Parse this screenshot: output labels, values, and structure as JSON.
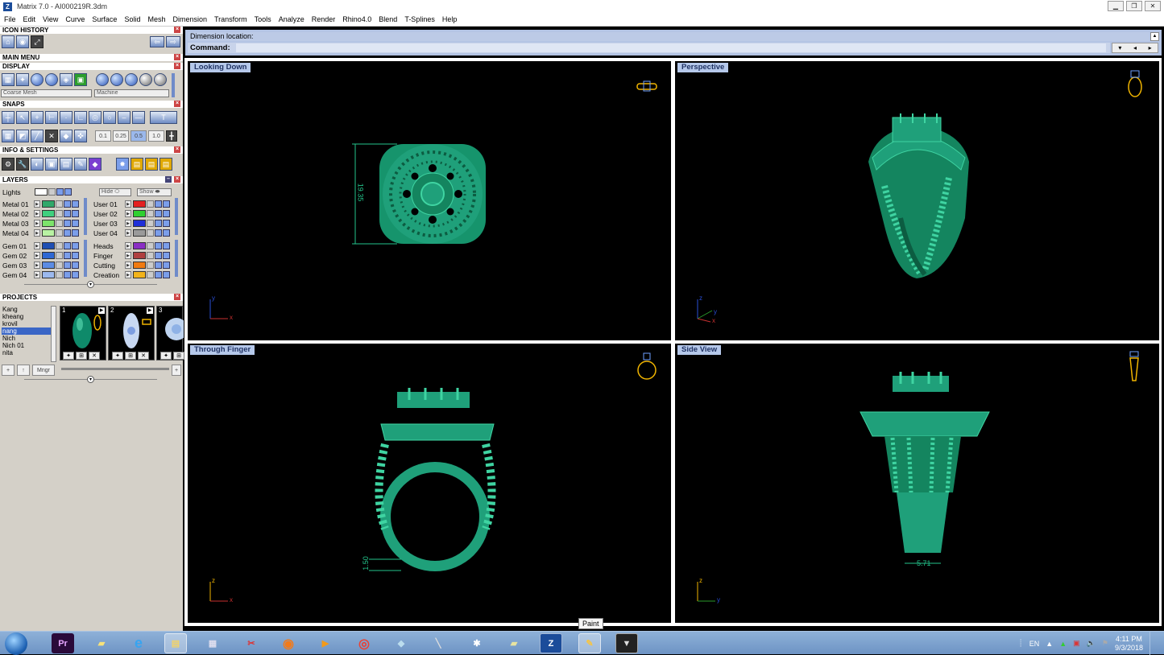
{
  "window": {
    "title": "Matrix 7.0 - AI000219R.3dm",
    "minimize": "▁",
    "restore": "❐",
    "close": "✕"
  },
  "menu": [
    "File",
    "Edit",
    "View",
    "Curve",
    "Surface",
    "Solid",
    "Mesh",
    "Dimension",
    "Transform",
    "Tools",
    "Analyze",
    "Render",
    "Rhino4.0",
    "Blend",
    "T-Splines",
    "Help"
  ],
  "left_panel": {
    "icon_history": "ICON HISTORY",
    "main_menu": "MAIN MENU",
    "display": "DISPLAY",
    "display_mesh": "Coarse Mesh",
    "display_mode": "Machine",
    "snaps": "SNAPS",
    "snap_values": [
      "0.1",
      "0.25",
      "0.5",
      "1.0"
    ],
    "info_settings": "INFO & SETTINGS",
    "layers": "LAYERS",
    "lights": "Lights",
    "hide": "Hide",
    "show": "Show",
    "layers_left": [
      {
        "name": "Metal 01",
        "color": "#2fa86a"
      },
      {
        "name": "Metal 02",
        "color": "#3fd07f"
      },
      {
        "name": "Metal 03",
        "color": "#7de36b"
      },
      {
        "name": "Metal 04",
        "color": "#b9f2a3"
      },
      {
        "name": "Gem 01",
        "color": "#1f4fb3"
      },
      {
        "name": "Gem 02",
        "color": "#2f68d4"
      },
      {
        "name": "Gem 03",
        "color": "#5c8ce4"
      },
      {
        "name": "Gem 04",
        "color": "#9cb9ee"
      }
    ],
    "layers_right": [
      {
        "name": "User 01",
        "color": "#e32020"
      },
      {
        "name": "User 02",
        "color": "#2fd02f"
      },
      {
        "name": "User 03",
        "color": "#1f2fd8"
      },
      {
        "name": "User 04",
        "color": "#9a9a9a"
      },
      {
        "name": "Heads",
        "color": "#8b2fc4"
      },
      {
        "name": "Finger",
        "color": "#b04040"
      },
      {
        "name": "Cutting",
        "color": "#f07a10"
      },
      {
        "name": "Creation",
        "color": "#f2b31a"
      }
    ],
    "projects": "PROJECTS",
    "project_list": [
      "Kang",
      "kheang",
      "krovil",
      "nang",
      "Nich",
      "Nich 01",
      "nita"
    ],
    "project_selected": "nang",
    "thumb_numbers": [
      "1",
      "2",
      "3"
    ],
    "mngr": "Mngr"
  },
  "command": {
    "prompt": "Dimension location:",
    "label": "Command:"
  },
  "viewports": [
    {
      "label": "Looking Down",
      "axes": [
        "y",
        "x"
      ],
      "dimension": "19.35"
    },
    {
      "label": "Perspective",
      "axes": [
        "z",
        "y",
        "x"
      ]
    },
    {
      "label": "Through Finger",
      "axes": [
        "z",
        "x"
      ],
      "dimension": "1.50"
    },
    {
      "label": "Side View",
      "axes": [
        "z",
        "y"
      ],
      "dimension": "5.71"
    }
  ],
  "colors": {
    "model": "#1fa07a",
    "model_light": "#3fd4a2",
    "dimension": "#23c48b",
    "accent": "#f0b400"
  },
  "taskbar": {
    "tooltip": "Paint",
    "lang": "EN",
    "time": "4:11 PM",
    "date": "9/3/2018",
    "premiere": "Pr",
    "matrix": "Z"
  }
}
